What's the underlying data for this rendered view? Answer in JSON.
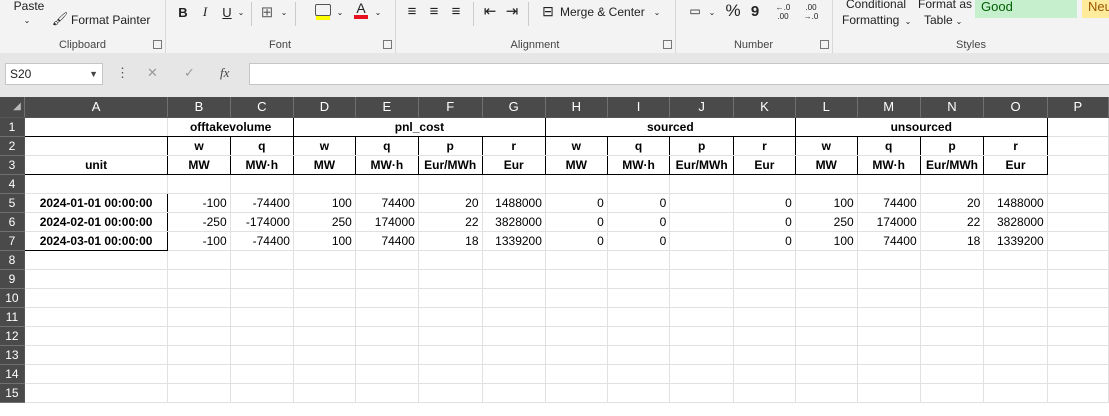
{
  "ribbon": {
    "clipboard": {
      "label": "Clipboard",
      "paste": "Paste",
      "format_painter": "Format Painter"
    },
    "font": {
      "label": "Font",
      "bold": "B",
      "italic": "I",
      "underline": "U"
    },
    "alignment": {
      "label": "Alignment",
      "merge_center": "Merge & Center"
    },
    "number": {
      "label": "Number",
      "percent": "%",
      "comma": "9",
      "inc_dec": "←.0 .00",
      "dec_dec": ".00 →.0"
    },
    "styles": {
      "label": "Styles",
      "conditional": "Conditional",
      "formatting": "Formatting",
      "format_as": "Format as",
      "table": "Table",
      "good": "Good",
      "neutral": "Neu"
    },
    "colors": {
      "good_bg": "#c6efce",
      "good_fg": "#006100",
      "neutral_bg": "#ffeb9c",
      "neutral_fg": "#9c5700",
      "font_color": "#e81123",
      "highlight": "#ffff00"
    }
  },
  "formula_bar": {
    "name_box": "S20",
    "fx": "fx",
    "value": ""
  },
  "grid": {
    "columns": [
      "A",
      "B",
      "C",
      "D",
      "E",
      "F",
      "G",
      "H",
      "I",
      "J",
      "K",
      "L",
      "M",
      "N",
      "O",
      "P"
    ],
    "row_numbers": [
      "1",
      "2",
      "3",
      "4",
      "5",
      "6",
      "7",
      "8",
      "9",
      "10",
      "11",
      "12",
      "13",
      "14",
      "15"
    ],
    "groups": [
      "offtakevolume",
      "pnl_cost",
      "sourced",
      "unsourced"
    ],
    "sub_headers": [
      "w",
      "q",
      "w",
      "q",
      "p",
      "r",
      "w",
      "q",
      "p",
      "r",
      "w",
      "q",
      "p",
      "r"
    ],
    "unit_label": "unit",
    "units": [
      "MW",
      "MW·h",
      "MW",
      "MW·h",
      "Eur/MWh",
      "Eur",
      "MW",
      "MW·h",
      "Eur/MWh",
      "Eur",
      "MW",
      "MW·h",
      "Eur/MWh",
      "Eur"
    ],
    "data_rows": [
      [
        "2024-01-01 00:00:00",
        "-100",
        "-74400",
        "100",
        "74400",
        "20",
        "1488000",
        "0",
        "0",
        "",
        "0",
        "100",
        "74400",
        "20",
        "1488000"
      ],
      [
        "2024-02-01 00:00:00",
        "-250",
        "-174000",
        "250",
        "174000",
        "22",
        "3828000",
        "0",
        "0",
        "",
        "0",
        "250",
        "174000",
        "22",
        "3828000"
      ],
      [
        "2024-03-01 00:00:00",
        "-100",
        "-74400",
        "100",
        "74400",
        "18",
        "1339200",
        "0",
        "0",
        "",
        "0",
        "100",
        "74400",
        "18",
        "1339200"
      ]
    ]
  }
}
